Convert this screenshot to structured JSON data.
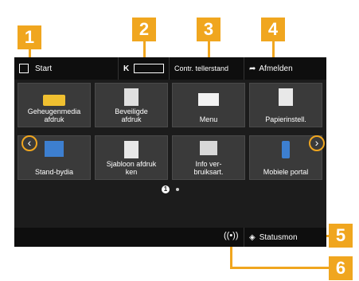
{
  "callouts": [
    "1",
    "2",
    "3",
    "4",
    "5",
    "6"
  ],
  "topbar": {
    "start_label": "Start",
    "counter_label": "K",
    "counter_value": "",
    "contr_label": "Contr. tellerstand",
    "logout_label": "Afmelden"
  },
  "tiles": [
    {
      "label": "Geheugenmedia\nafdruk",
      "icon": "memory-card-icon"
    },
    {
      "label": "Beveiligde\nafdruk",
      "icon": "secure-print-icon"
    },
    {
      "label": "Menu",
      "icon": "menu-icon"
    },
    {
      "label": "Papierinstell.",
      "icon": "paper-settings-icon"
    },
    {
      "label": "Stand-bydia",
      "icon": "standby-slideshow-icon"
    },
    {
      "label": "Sjabloon afdruk\nken",
      "icon": "template-print-icon"
    },
    {
      "label": "Info ver-\nbruiksart.",
      "icon": "consumables-info-icon"
    },
    {
      "label": "Mobiele portal",
      "icon": "mobile-portal-icon"
    }
  ],
  "page_dots": [
    "1"
  ],
  "statusbar": {
    "status_label": "Statusmon"
  },
  "colors": {
    "accent": "#f0a61f",
    "screen_bg": "#1c1c1c"
  }
}
